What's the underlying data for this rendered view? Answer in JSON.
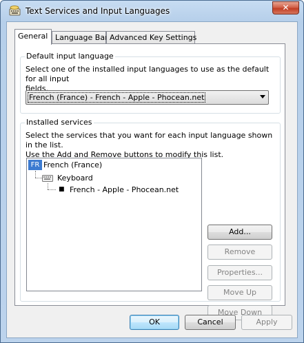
{
  "window": {
    "title": "Text Services and Input Languages",
    "close_glyph": "✕"
  },
  "tabs": [
    {
      "label": "General",
      "active": true
    },
    {
      "label": "Language Bar",
      "active": false
    },
    {
      "label": "Advanced Key Settings",
      "active": false
    }
  ],
  "default_language": {
    "group_label": "Default input language",
    "description_line1": "Select one of the installed input languages to use as the default for all input",
    "description_line2": "fields.",
    "selected_value": "French (France) - French - Apple - Phocean.net"
  },
  "installed_services": {
    "group_label": "Installed services",
    "description_line1": "Select the services that you want for each input language shown in the list.",
    "description_line2": "Use the Add and Remove buttons to modify this list.",
    "tree": {
      "language_badge": "FR",
      "language": "French (France)",
      "category": "Keyboard",
      "service": "French - Apple - Phocean.net"
    },
    "buttons": {
      "add": "Add...",
      "remove": "Remove",
      "properties": "Properties...",
      "move_up": "Move Up",
      "move_down": "Move Down"
    }
  },
  "footer": {
    "ok": "OK",
    "cancel": "Cancel",
    "apply": "Apply"
  },
  "colors": {
    "titlebar": "#bcd3ec",
    "close_button": "#c13e23",
    "language_badge": "#3c7bd1",
    "disabled_text": "#838383"
  },
  "icons": [
    "keyboard-settings-icon",
    "close-icon",
    "keyboard-icon"
  ]
}
